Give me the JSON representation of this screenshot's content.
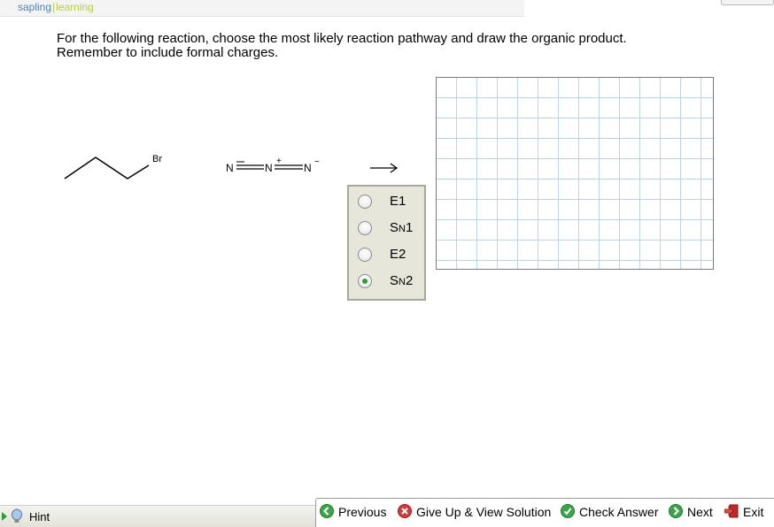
{
  "brand": {
    "part1": "sapling",
    "part2": "learning"
  },
  "question": {
    "line1": "For the following reaction, choose the most likely reaction pathway and draw the organic product.",
    "line2": "Remember to include formal charges."
  },
  "reactants": {
    "alkyl_halide_label": "Br",
    "azide": {
      "n1": "N",
      "n2": "N",
      "n3": "N",
      "charge_plus": "+",
      "charge_minus": "−"
    }
  },
  "options": [
    {
      "main": "E1",
      "sub": "",
      "tail": "",
      "selected": false
    },
    {
      "main": "S",
      "sub": "N",
      "tail": "1",
      "selected": false
    },
    {
      "main": "E2",
      "sub": "",
      "tail": "",
      "selected": false
    },
    {
      "main": "S",
      "sub": "N",
      "tail": "2",
      "selected": true
    }
  ],
  "bottom": {
    "hint": "Hint"
  },
  "nav": {
    "previous": "Previous",
    "give_up": "Give Up & View Solution",
    "check": "Check Answer",
    "next": "Next",
    "exit": "Exit"
  },
  "colors": {
    "accent_green": "#2a9c3a",
    "exit_red": "#c62828",
    "brand_blue": "#4a86b8",
    "brand_green": "#b8cc4a"
  }
}
